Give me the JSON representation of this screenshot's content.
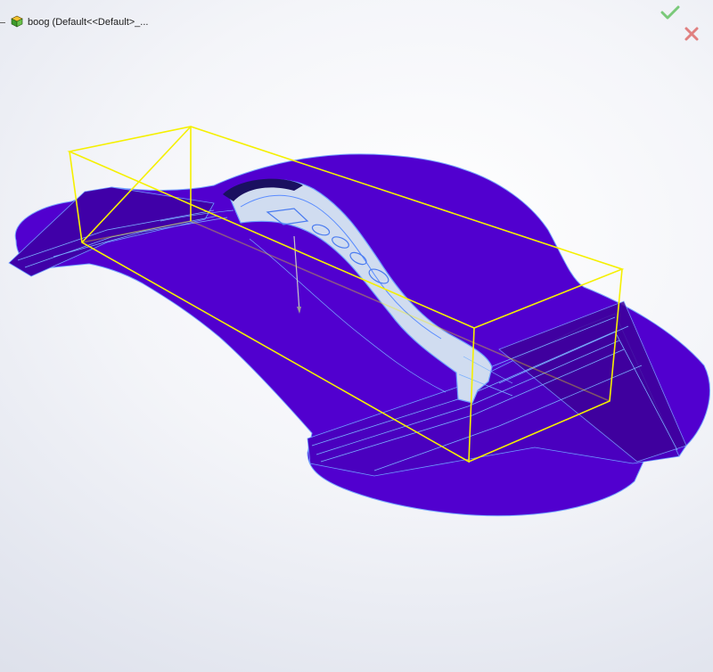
{
  "feature_tree": {
    "part_label": "boog  (Default<<Default>_...",
    "icon": "part-icon"
  },
  "confirm": {
    "ok_icon": "checkmark-icon",
    "cancel_icon": "close-icon",
    "ok_color": "#7ac97a",
    "cancel_color": "#e08080"
  },
  "colors": {
    "model_fill": "#5100cf",
    "model_edge": "#78a8ff",
    "bounding_box": "#f5f000",
    "selected_face": "#d0dcf0"
  }
}
